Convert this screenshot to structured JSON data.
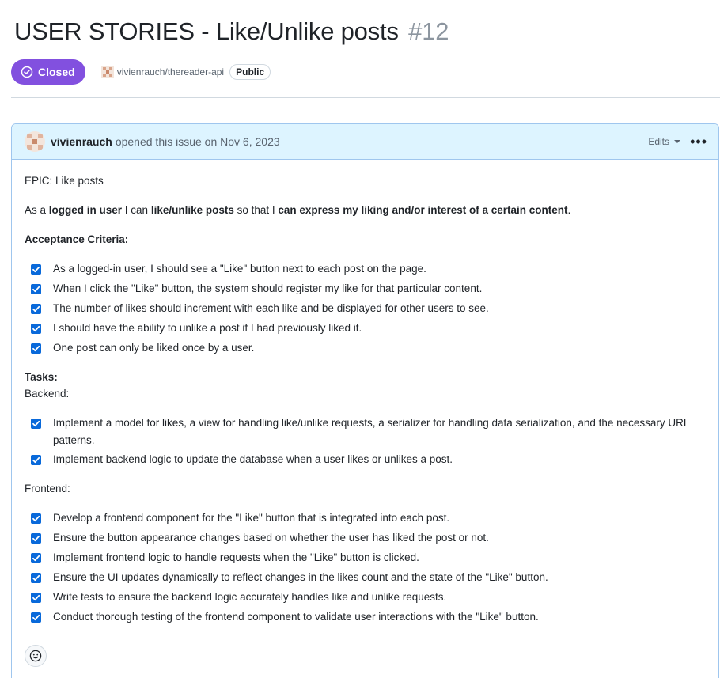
{
  "issue": {
    "title": "USER STORIES - Like/Unlike posts",
    "number": "#12",
    "state": "Closed",
    "repo": "vivienrauch/thereader-api",
    "visibility": "Public"
  },
  "comment": {
    "author": "vivienrauch",
    "opened_text": "opened this issue on Nov 6, 2023",
    "edits_label": "Edits",
    "epic": "EPIC: Like posts",
    "story": {
      "p1": "As a ",
      "b1": "logged in user",
      "p2": " I can ",
      "b2": "like/unlike posts",
      "p3": " so that I ",
      "b3": "can express my liking and/or interest of a certain content",
      "p4": "."
    },
    "acceptance_heading": "Acceptance Criteria:",
    "acceptance": [
      "As a logged-in user, I should see a \"Like\" button next to each post on the page.",
      "When I click the \"Like\" button, the system should register my like for that particular content.",
      "The number of likes should increment with each like and be displayed for other users to see.",
      "I should have the ability to unlike a post if I had previously liked it.",
      "One post can only be liked once by a user."
    ],
    "tasks_heading": "Tasks:",
    "backend_heading": "Backend:",
    "backend": [
      "Implement a model for likes, a view for handling like/unlike requests, a serializer for handling data serialization, and the necessary URL patterns.",
      "Implement backend logic to update the database when a user likes or unlikes a post."
    ],
    "frontend_heading": "Frontend:",
    "frontend": [
      "Develop a frontend component for the \"Like\" button that is integrated into each post.",
      "Ensure the button appearance changes based on whether the user has liked the post or not.",
      "Implement frontend logic to handle requests when the \"Like\" button is clicked.",
      "Ensure the UI updates dynamically to reflect changes in the likes count and the state of the \"Like\" button.",
      "Write tests to ensure the backend logic accurately handles like and unlike requests.",
      "Conduct thorough testing of the frontend component to validate user interactions with the \"Like\" button."
    ]
  },
  "icons": {
    "state": "check-circle-icon",
    "reaction": "smiley-icon",
    "menu": "kebab-horizontal-icon"
  },
  "colors": {
    "closed_badge": "#8250df",
    "header_bg": "#ddf4ff",
    "header_border": "#9fc6ee",
    "checkbox": "#0969da"
  }
}
